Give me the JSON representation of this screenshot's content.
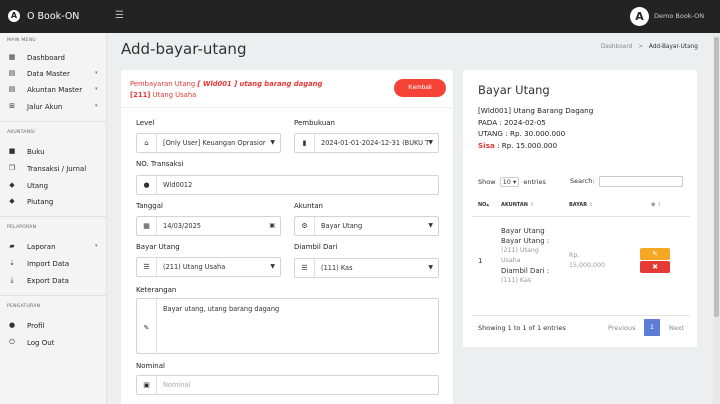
{
  "header": {
    "brand": "O Book-ON",
    "logo_letter": "A",
    "user_name": "Demo Book-ON"
  },
  "sidebar": {
    "main_menu": "MAIN MENU",
    "main_items": [
      {
        "icon": "dashboard-icon",
        "label": "Dashboard",
        "has_caret": false
      },
      {
        "icon": "master-data-icon",
        "label": "Data Master",
        "has_caret": true
      },
      {
        "icon": "accounting-master-icon",
        "label": "Akuntan Master",
        "has_caret": true
      },
      {
        "icon": "account-path-icon",
        "label": "Jalur Akun",
        "has_caret": true
      }
    ],
    "akuntansi": "AKUNTANSI",
    "akuntansi_items": [
      {
        "icon": "book-icon",
        "label": "Buku"
      },
      {
        "icon": "journal-icon",
        "label": "Transaksi / Jurnal"
      },
      {
        "icon": "debt-tag-icon",
        "label": "Utang"
      },
      {
        "icon": "receivable-tag-icon",
        "label": "Piutang"
      }
    ],
    "laporan": "PELAPORAN",
    "laporan_items": [
      {
        "icon": "report-folder-icon",
        "label": "Laporan",
        "has_caret": true
      },
      {
        "icon": "import-icon",
        "label": "Import Data"
      },
      {
        "icon": "export-icon",
        "label": "Export Data"
      }
    ],
    "pengaturan": "PENGATURAN",
    "pengaturan_items": [
      {
        "icon": "user-icon",
        "label": "Profil"
      },
      {
        "icon": "power-icon",
        "label": "Log Out"
      }
    ]
  },
  "page": {
    "title": "Add-bayar-utang",
    "breadcrumb_root": "Dashboard",
    "breadcrumb_sep": ">",
    "breadcrumb_current": "Add-Bayar-Utang"
  },
  "form": {
    "header_prefix": "Pembayaran Utang",
    "header_ref": "[ Wld001 ] utang barang dagang",
    "header_code": "[211]",
    "header_account": "Utang Usaha",
    "kembali": "Kembali",
    "level_label": "Level",
    "level_value": "[Only User] Keuangan Oprasior",
    "pembukuan_label": "Pembukuan",
    "pembukuan_value": "2024-01-01-2024-12-31 (BUKU T.",
    "no_label": "NO. Transaksi",
    "no_value": "Wld0012",
    "tanggal_label": "Tanggal",
    "tanggal_value": "14/03/2025",
    "akuntan_label": "Akuntan",
    "akuntan_value": "Bayar Utang",
    "bayar_label": "Bayar Utang",
    "bayar_value": "(211) Utang Usaha",
    "diambil_label": "Diambil Dari",
    "diambil_value": "(111) Kas",
    "keterangan_label": "Keterangan",
    "keterangan_value": "Bayar utang, utang barang dagang",
    "nominal_label": "Nominal",
    "nominal_placeholder": "Nominal"
  },
  "panel": {
    "title": "Bayar Utang",
    "ref": "[Wld001] Utang Barang Dagang",
    "pada": "PADA : 2024-02-05",
    "utang": "UTANG : Rp. 30.000.000",
    "sisa_label": "Sisa",
    "sisa_value": ": Rp. 15.000.000",
    "show": "Show",
    "show_value": "10",
    "entries": "entries",
    "search": "Search:",
    "col_no": "NO",
    "col_akuntan": "AKUNTAN",
    "col_bayar": "BAYAR",
    "row": {
      "no": "1",
      "akuntan_title": "Bayar Utang",
      "akuntan_sub1": "Bayar Utang :",
      "akuntan_sub1_val1": "(211) Utang",
      "akuntan_sub1_val2": "Usaha",
      "akuntan_sub2": "Diambil Dari :",
      "akuntan_sub2_val": "(111) Kas",
      "bayar1": "Rp.",
      "bayar2": "15,000,000"
    },
    "showing": "Showing 1 to 1 of 1 entries",
    "previous": "Previous",
    "page": "1",
    "next": "Next"
  }
}
